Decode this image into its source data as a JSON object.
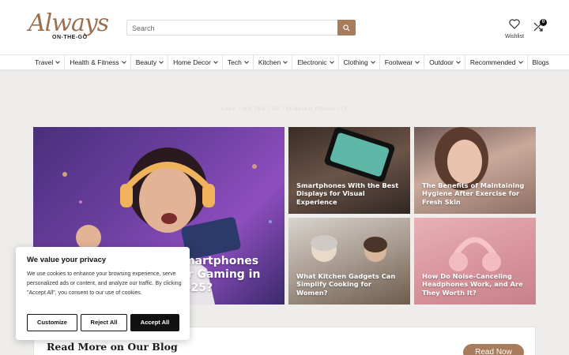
{
  "header": {
    "logo_script": "Always",
    "logo_sub": "ON-THE-GO",
    "search_placeholder": "Search",
    "wishlist_label": "Wishlist",
    "compare_count": "0"
  },
  "nav": {
    "items": [
      "Travel",
      "Health & Fitness",
      "Beauty",
      "Home Decor",
      "Tech",
      "Kitchen",
      "Electronic",
      "Clothing",
      "Footwear",
      "Outdoor",
      "Recommended",
      "Blogs"
    ]
  },
  "tagline": "HAVE LIKE THE TOP TRENDING PRODUCTS",
  "featured": {
    "big_title": "Smartphones for Gaming in 2025?",
    "cards": [
      "Smartphones With the Best Displays for Visual Experience",
      "The Benefits of Maintaining Hygiene After Exercise for Fresh Skin",
      "What Kitchen Gadgets Can Simplify Cooking for Women?",
      "How Do Noise-Canceling Headphones Work, and Are They Worth It?"
    ]
  },
  "blog": {
    "heading": "Read More on Our Blog",
    "button": "Read Now"
  },
  "cookie": {
    "title": "We value your privacy",
    "body": "We use cookies to enhance your browsing experience, serve personalized ads or content, and analyze our traffic. By clicking \"Accept All\", you consent to our use of cookies.",
    "customize": "Customize",
    "reject": "Reject All",
    "accept": "Accept All"
  },
  "colors": {
    "accent": "#a77c5d",
    "background": "#eeedeb"
  }
}
